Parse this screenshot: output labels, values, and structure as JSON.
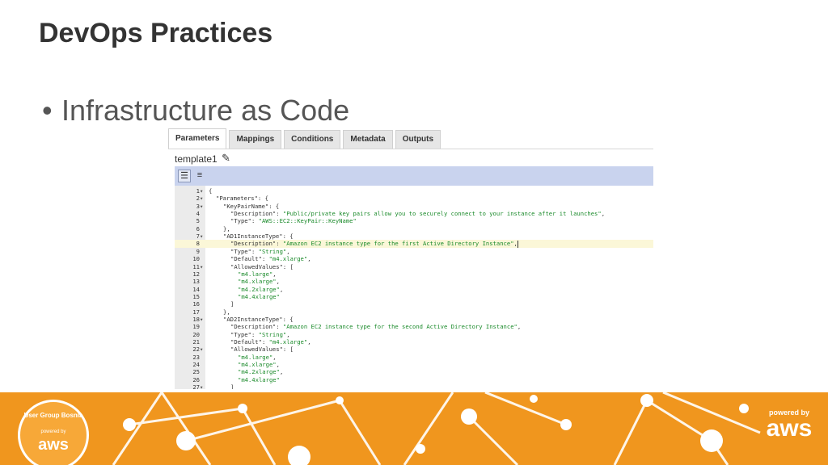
{
  "slide": {
    "title": "DevOps Practices",
    "bullet": "Infrastructure as Code"
  },
  "editor": {
    "tabs": [
      "Parameters",
      "Mappings",
      "Conditions",
      "Metadata",
      "Outputs"
    ],
    "active_tab": "Parameters",
    "template_name": "template1",
    "icons": {
      "edit": "pencil-icon",
      "toolbar": [
        "format-icon",
        "outline-icon"
      ]
    },
    "code_lines": [
      {
        "n": "1",
        "fold": "▾",
        "indent": 0,
        "parts": [
          {
            "t": "{",
            "c": "k"
          }
        ]
      },
      {
        "n": "2",
        "fold": "▾",
        "indent": 1,
        "parts": [
          {
            "t": "\"Parameters\": {",
            "c": "k"
          }
        ]
      },
      {
        "n": "3",
        "fold": "▾",
        "indent": 2,
        "parts": [
          {
            "t": "\"KeyPairName\": {",
            "c": "k"
          }
        ]
      },
      {
        "n": "4",
        "fold": "",
        "indent": 3,
        "parts": [
          {
            "t": "\"Description\": ",
            "c": "k"
          },
          {
            "t": "\"Public/private key pairs allow you to securely connect to your instance after it launches\"",
            "c": "s"
          },
          {
            "t": ",",
            "c": "k"
          }
        ]
      },
      {
        "n": "5",
        "fold": "",
        "indent": 3,
        "parts": [
          {
            "t": "\"Type\": ",
            "c": "k"
          },
          {
            "t": "\"AWS::EC2::KeyPair::KeyName\"",
            "c": "s"
          }
        ]
      },
      {
        "n": "6",
        "fold": "",
        "indent": 2,
        "parts": [
          {
            "t": "},",
            "c": "k"
          }
        ]
      },
      {
        "n": "7",
        "fold": "▾",
        "indent": 2,
        "parts": [
          {
            "t": "\"AD1InstanceType\": {",
            "c": "k"
          }
        ]
      },
      {
        "n": "8",
        "fold": "",
        "indent": 3,
        "hl": true,
        "cursor": true,
        "parts": [
          {
            "t": "\"Description\": ",
            "c": "k"
          },
          {
            "t": "\"Amazon EC2 instance type for the first Active Directory Instance\"",
            "c": "s"
          },
          {
            "t": ",",
            "c": "k"
          }
        ]
      },
      {
        "n": "9",
        "fold": "",
        "indent": 3,
        "parts": [
          {
            "t": "\"Type\": ",
            "c": "k"
          },
          {
            "t": "\"String\"",
            "c": "s"
          },
          {
            "t": ",",
            "c": "k"
          }
        ]
      },
      {
        "n": "10",
        "fold": "",
        "indent": 3,
        "parts": [
          {
            "t": "\"Default\": ",
            "c": "k"
          },
          {
            "t": "\"m4.xlarge\"",
            "c": "s"
          },
          {
            "t": ",",
            "c": "k"
          }
        ]
      },
      {
        "n": "11",
        "fold": "▾",
        "indent": 3,
        "parts": [
          {
            "t": "\"AllowedValues\": [",
            "c": "k"
          }
        ]
      },
      {
        "n": "12",
        "fold": "",
        "indent": 4,
        "parts": [
          {
            "t": "\"m4.large\"",
            "c": "s"
          },
          {
            "t": ",",
            "c": "k"
          }
        ]
      },
      {
        "n": "13",
        "fold": "",
        "indent": 4,
        "parts": [
          {
            "t": "\"m4.xlarge\"",
            "c": "s"
          },
          {
            "t": ",",
            "c": "k"
          }
        ]
      },
      {
        "n": "14",
        "fold": "",
        "indent": 4,
        "parts": [
          {
            "t": "\"m4.2xlarge\"",
            "c": "s"
          },
          {
            "t": ",",
            "c": "k"
          }
        ]
      },
      {
        "n": "15",
        "fold": "",
        "indent": 4,
        "parts": [
          {
            "t": "\"m4.4xlarge\"",
            "c": "s"
          }
        ]
      },
      {
        "n": "16",
        "fold": "",
        "indent": 3,
        "parts": [
          {
            "t": "]",
            "c": "k"
          }
        ]
      },
      {
        "n": "17",
        "fold": "",
        "indent": 2,
        "parts": [
          {
            "t": "},",
            "c": "k"
          }
        ]
      },
      {
        "n": "18",
        "fold": "▾",
        "indent": 2,
        "parts": [
          {
            "t": "\"AD2InstanceType\": {",
            "c": "k"
          }
        ]
      },
      {
        "n": "19",
        "fold": "",
        "indent": 3,
        "parts": [
          {
            "t": "\"Description\": ",
            "c": "k"
          },
          {
            "t": "\"Amazon EC2 instance type for the second Active Directory Instance\"",
            "c": "s"
          },
          {
            "t": ",",
            "c": "k"
          }
        ]
      },
      {
        "n": "20",
        "fold": "",
        "indent": 3,
        "parts": [
          {
            "t": "\"Type\": ",
            "c": "k"
          },
          {
            "t": "\"String\"",
            "c": "s"
          },
          {
            "t": ",",
            "c": "k"
          }
        ]
      },
      {
        "n": "21",
        "fold": "",
        "indent": 3,
        "parts": [
          {
            "t": "\"Default\": ",
            "c": "k"
          },
          {
            "t": "\"m4.xlarge\"",
            "c": "s"
          },
          {
            "t": ",",
            "c": "k"
          }
        ]
      },
      {
        "n": "22",
        "fold": "▾",
        "indent": 3,
        "parts": [
          {
            "t": "\"AllowedValues\": [",
            "c": "k"
          }
        ]
      },
      {
        "n": "23",
        "fold": "",
        "indent": 4,
        "parts": [
          {
            "t": "\"m4.large\"",
            "c": "s"
          },
          {
            "t": ",",
            "c": "k"
          }
        ]
      },
      {
        "n": "24",
        "fold": "",
        "indent": 4,
        "parts": [
          {
            "t": "\"m4.xlarge\"",
            "c": "s"
          },
          {
            "t": ",",
            "c": "k"
          }
        ]
      },
      {
        "n": "25",
        "fold": "",
        "indent": 4,
        "parts": [
          {
            "t": "\"m4.2xlarge\"",
            "c": "s"
          },
          {
            "t": ",",
            "c": "k"
          }
        ]
      },
      {
        "n": "26",
        "fold": "",
        "indent": 4,
        "parts": [
          {
            "t": "\"m4.4xlarge\"",
            "c": "s"
          }
        ]
      },
      {
        "n": "27",
        "fold": "▾",
        "indent": 3,
        "parts": [
          {
            "t": "]",
            "c": "k"
          }
        ]
      }
    ]
  },
  "footer": {
    "badge_top": "User Group Bosnia",
    "badge_powered": "powered by",
    "badge_aws": "aws",
    "powered_by": "powered by",
    "aws": "aws"
  },
  "colors": {
    "footer": "#f0961e",
    "string": "#1a8a2a",
    "toolbar": "#c9d3ee",
    "highlight": "#fbf7d8"
  }
}
